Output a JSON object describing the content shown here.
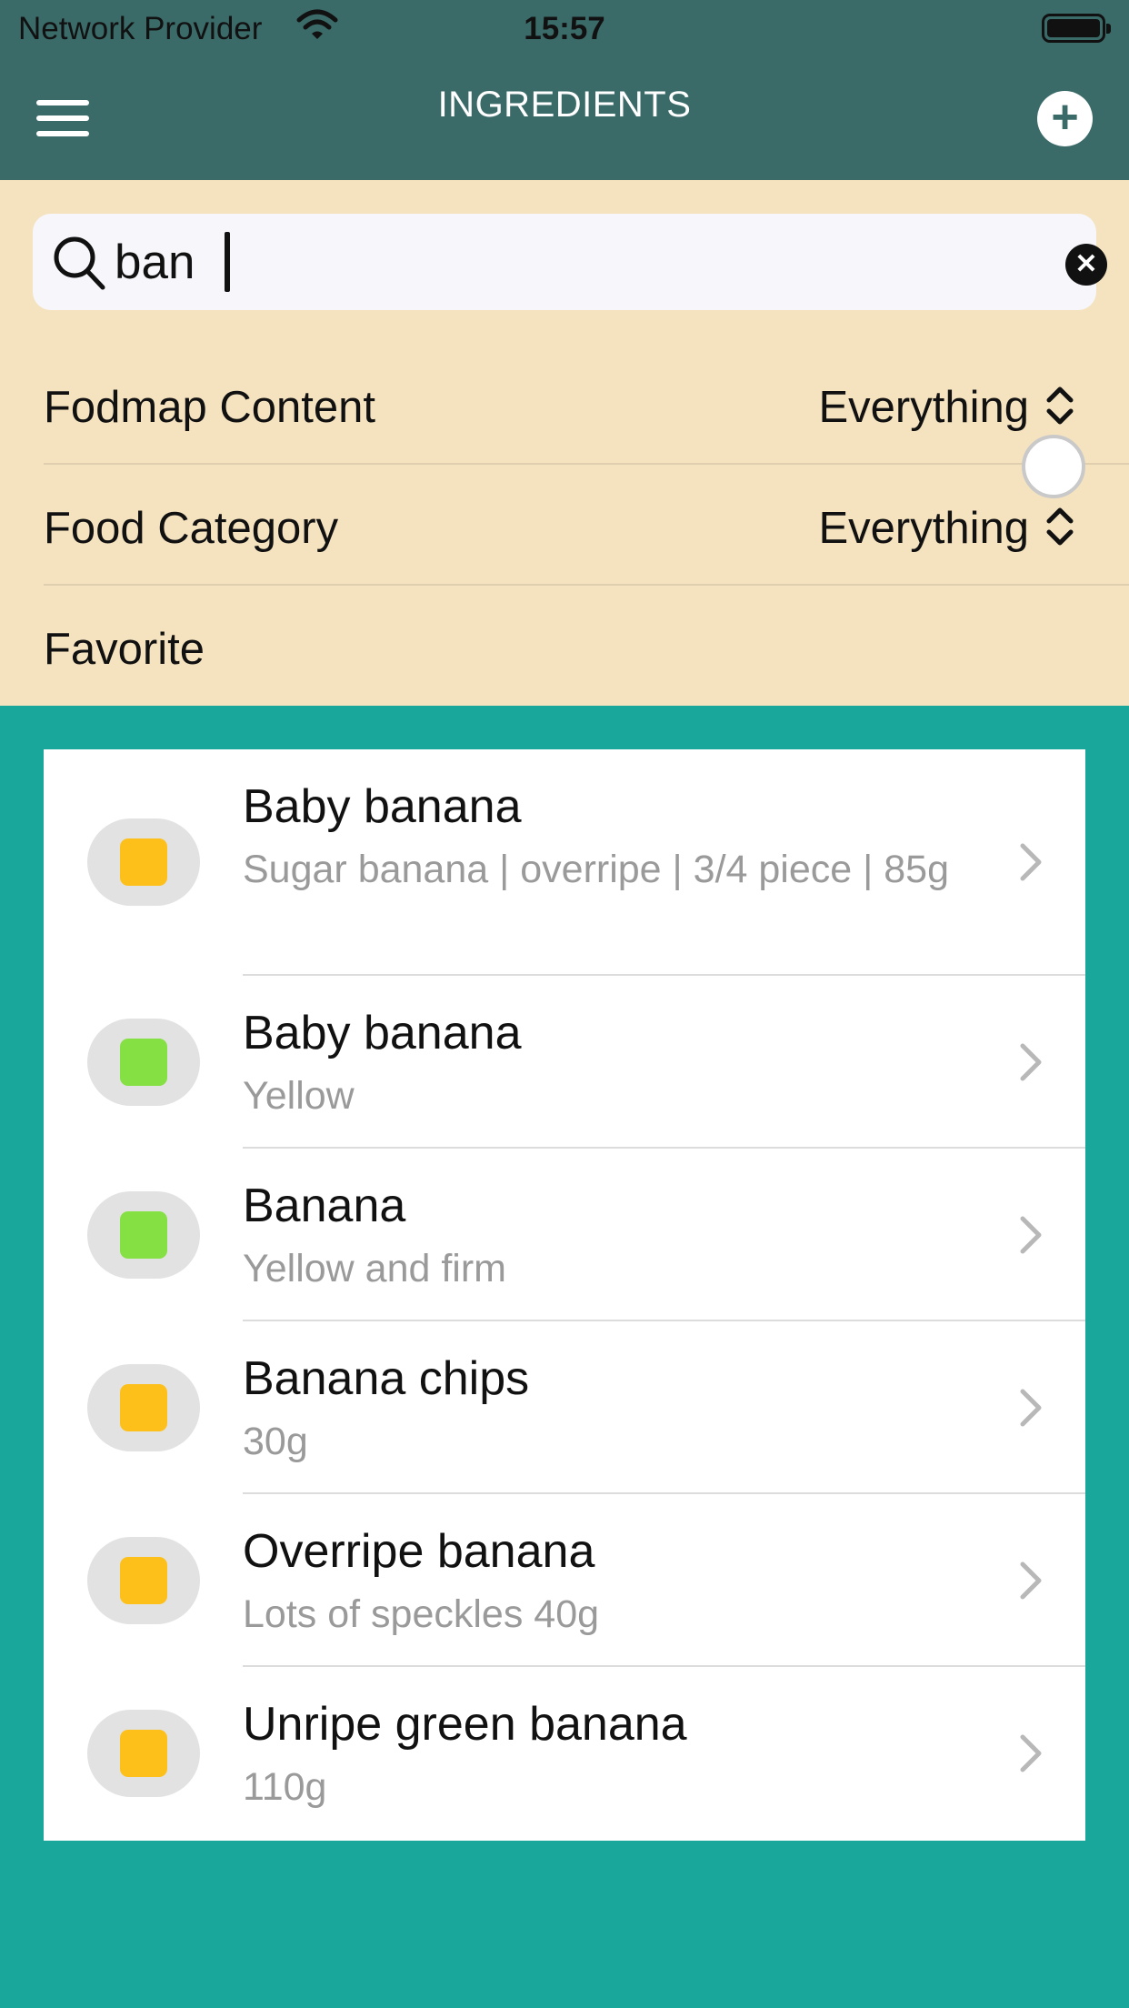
{
  "status_bar": {
    "carrier": "Network Provider",
    "time": "15:57"
  },
  "header": {
    "title": "INGREDIENTS",
    "menu_icon": "hamburger-menu-icon",
    "add_icon": "plus-icon"
  },
  "search": {
    "value": "ban",
    "clear_icon": "clear-x-icon"
  },
  "filters": {
    "fodmap_label": "Fodmap Content",
    "fodmap_value": "Everything",
    "category_label": "Food Category",
    "category_value": "Everything",
    "favorite_label": "Favorite",
    "favorite_on": false
  },
  "colors": {
    "header_bg": "#3b6b69",
    "filter_bg": "#f5e3c0",
    "page_bg": "#19a79c",
    "status_orange": "#fdc01a",
    "status_green": "#85e043"
  },
  "ingredients": [
    {
      "name": "Baby banana",
      "detail": "Sugar banana | overripe | 3/4 piece | 85g",
      "status": "orange"
    },
    {
      "name": "Baby banana",
      "detail": "Yellow",
      "status": "green"
    },
    {
      "name": "Banana",
      "detail": "Yellow and firm",
      "status": "green"
    },
    {
      "name": "Banana chips",
      "detail": "30g",
      "status": "orange"
    },
    {
      "name": "Overripe banana",
      "detail": "Lots of speckles 40g",
      "status": "orange"
    },
    {
      "name": "Unripe green banana",
      "detail": "110g",
      "status": "orange"
    }
  ]
}
